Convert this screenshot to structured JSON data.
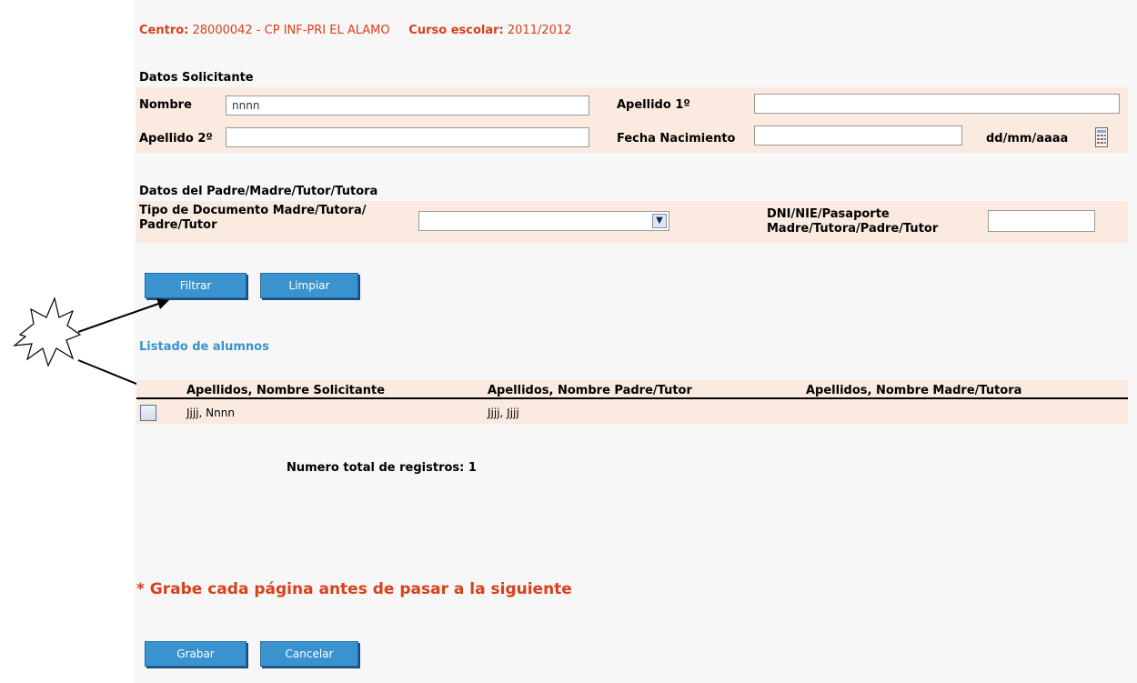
{
  "header": {
    "centro_label": "Centro:",
    "centro_value": "28000042 - CP INF-PRI EL ALAMO",
    "curso_label": "Curso escolar:",
    "curso_value": "2011/2012"
  },
  "solicitante": {
    "title": "Datos Solicitante",
    "nombre_label": "Nombre",
    "nombre_value": "nnnn",
    "apellido1_label": "Apellido 1º",
    "apellido1_value": "",
    "apellido2_label": "Apellido 2º",
    "apellido2_value": "",
    "fecha_label": "Fecha Nacimiento",
    "fecha_value": "",
    "fecha_format": "dd/mm/aaaa",
    "calendar_icon": "calendar-icon"
  },
  "padres": {
    "title": "Datos del Padre/Madre/Tutor/Tutora",
    "tipo_doc_label_1": "Tipo de Documento Madre/Tutora/",
    "tipo_doc_label_2": "Padre/Tutor",
    "tipo_doc_selected": "",
    "dni_label_1": "DNI/NIE/Pasaporte",
    "dni_label_2": "Madre/Tutora/Padre/Tutor",
    "dni_value": ""
  },
  "filter_buttons": {
    "filtrar": "Filtrar",
    "limpiar": "Limpiar"
  },
  "listado": {
    "title": "Listado de alumnos",
    "columns": [
      "Apellidos, Nombre Solicitante",
      "Apellidos, Nombre Padre/Tutor",
      "Apellidos, Nombre Madre/Tutora"
    ],
    "rows": [
      {
        "checked": false,
        "solicitante": "Jjjj, Nnnn",
        "padre": "Jjjj, Jjjj",
        "madre": ""
      }
    ],
    "total_label": "Numero total de registros: 1"
  },
  "warning": "* Grabe cada página antes de pasar a la siguiente",
  "action_buttons": {
    "grabar": "Grabar",
    "cancelar": "Cancelar"
  },
  "colors": {
    "accent_orange": "#d9401b",
    "accent_blue": "#3a93cf",
    "band": "#fbeadf"
  }
}
